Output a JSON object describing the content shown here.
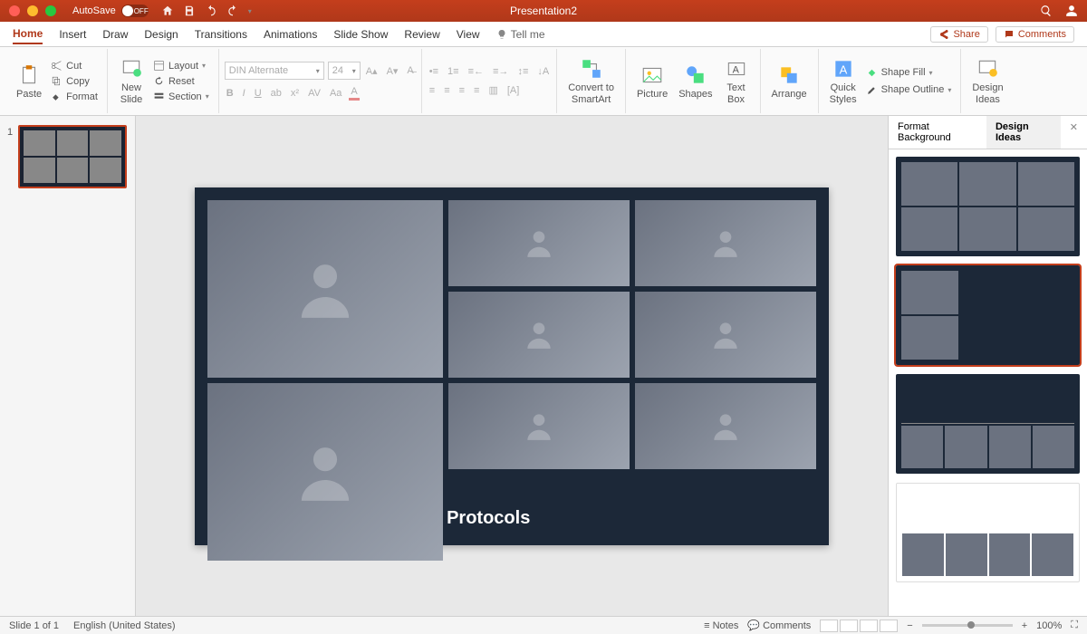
{
  "titlebar": {
    "autosave_label": "AutoSave",
    "autosave_state": "OFF",
    "doc_title": "Presentation2"
  },
  "tabs": {
    "home": "Home",
    "insert": "Insert",
    "draw": "Draw",
    "design": "Design",
    "transitions": "Transitions",
    "animations": "Animations",
    "slideshow": "Slide Show",
    "review": "Review",
    "view": "View",
    "tellme": "Tell me"
  },
  "ribbon_right": {
    "share": "Share",
    "comments": "Comments"
  },
  "ribbon": {
    "paste": "Paste",
    "cut": "Cut",
    "copy": "Copy",
    "format": "Format",
    "new_slide": "New\nSlide",
    "layout": "Layout",
    "reset": "Reset",
    "section": "Section",
    "font_name": "DIN Alternate",
    "font_size": "24",
    "convert_smartart": "Convert to\nSmartArt",
    "picture": "Picture",
    "shapes": "Shapes",
    "text_box": "Text\nBox",
    "arrange": "Arrange",
    "quick_styles": "Quick\nStyles",
    "shape_fill": "Shape Fill",
    "shape_outline": "Shape Outline",
    "design_ideas": "Design\nIdeas"
  },
  "slide": {
    "title": "Team Onboarding: Office Protocols",
    "number": "1"
  },
  "pane": {
    "tab1": "Format Background",
    "tab2": "Design Ideas"
  },
  "status": {
    "slide_info": "Slide 1 of 1",
    "language": "English (United States)",
    "notes": "Notes",
    "comments": "Comments",
    "zoom": "100%"
  }
}
